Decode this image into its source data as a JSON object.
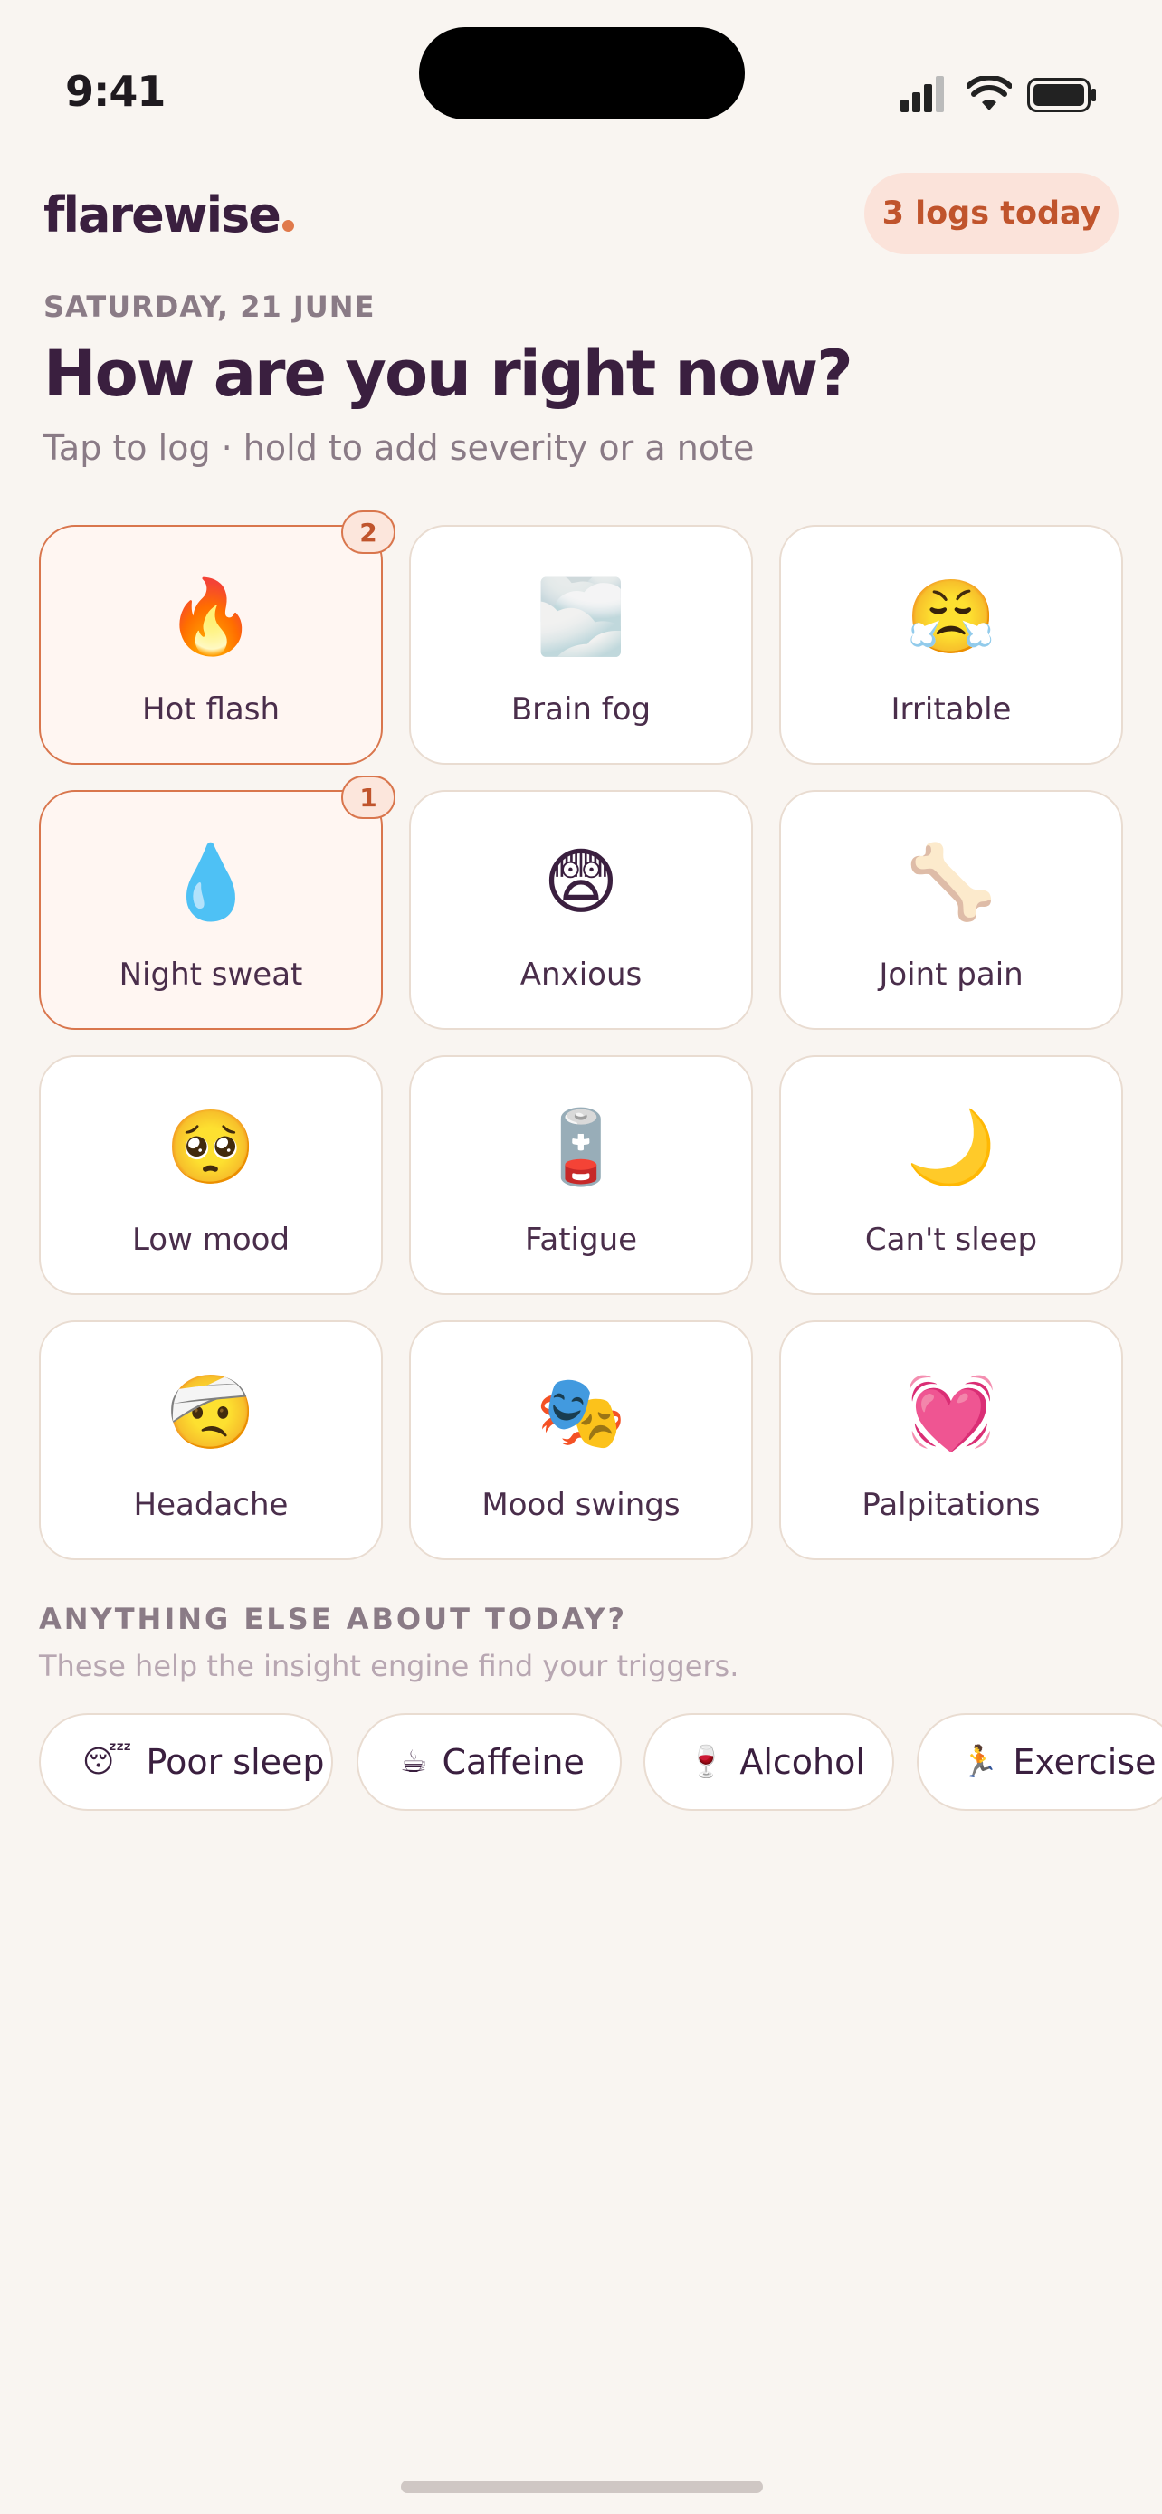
{
  "status_bar": {
    "time": "9:41"
  },
  "header": {
    "brand": "flarewise",
    "logs_today": "3 logs today"
  },
  "date": "SATURDAY, 21 JUNE",
  "headline": "How are you right now?",
  "subline": "Tap to log · hold to add severity or a note",
  "symptoms": [
    {
      "label": "Hot flash",
      "icon": "🔥",
      "icon_name": "fire-icon",
      "count": "2"
    },
    {
      "label": "Brain fog",
      "icon": "🌫️",
      "icon_name": "fog-icon"
    },
    {
      "label": "Irritable",
      "icon": "😤",
      "icon_name": "huffing-face-icon"
    },
    {
      "label": "Night sweat",
      "icon": "💧",
      "icon_name": "droplet-icon",
      "count": "1"
    },
    {
      "label": "Anxious",
      "icon": "😨",
      "icon_name": "fearful-face-icon"
    },
    {
      "label": "Joint pain",
      "icon": "🦴",
      "icon_name": "bone-icon"
    },
    {
      "label": "Low mood",
      "icon": "🥺",
      "icon_name": "pleading-face-icon"
    },
    {
      "label": "Fatigue",
      "icon": "🪫",
      "icon_name": "low-battery-icon"
    },
    {
      "label": "Can't sleep",
      "icon": "🌙",
      "icon_name": "crescent-moon-icon"
    },
    {
      "label": "Headache",
      "icon": "🤕",
      "icon_name": "bandaged-head-icon"
    },
    {
      "label": "Mood swings",
      "icon": "🎭",
      "icon_name": "theater-masks-icon"
    },
    {
      "label": "Palpitations",
      "icon": "💓",
      "icon_name": "beating-heart-icon"
    }
  ],
  "extras": {
    "title": "ANYTHING ELSE ABOUT TODAY?",
    "subtitle": "These help the insight engine find your triggers.",
    "chips": [
      {
        "label": "Poor sleep",
        "icon": "😴",
        "icon_name": "sleeping-face-icon"
      },
      {
        "label": "Caffeine",
        "icon": "☕",
        "icon_name": "coffee-icon"
      },
      {
        "label": "Alcohol",
        "icon": "🍷",
        "icon_name": "wine-glass-icon"
      },
      {
        "label": "Exercise",
        "icon": "🏃",
        "icon_name": "running-icon"
      }
    ]
  },
  "colors": {
    "accent": "#d9764d",
    "brand_text": "#3a1f3f",
    "background": "#f9f5f1"
  }
}
